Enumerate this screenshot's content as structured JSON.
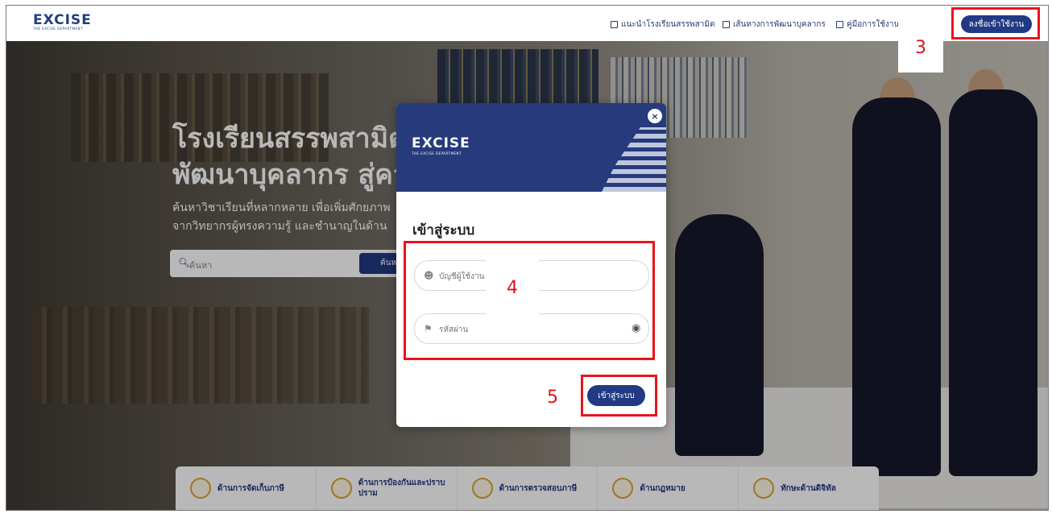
{
  "header": {
    "logo_text": "EXCISE",
    "logo_subtext": "THE EXCISE DEPARTMENT",
    "nav": [
      {
        "label": "แนะนำโรงเรียนสรรพสามิต"
      },
      {
        "label": "เส้นทางการพัฒนาบุคลากร"
      },
      {
        "label": "คู่มือการใช้งาน"
      }
    ],
    "register_label": "ลงชื่อเข้าใช้งาน"
  },
  "hero": {
    "title_line1": "โรงเรียนสรรพสามิต",
    "title_line2": "พัฒนาบุคลากร สู่ความ",
    "subtitle_line1": "ค้นหาวิชาเรียนที่หลากหลาย เพื่อเพิ่มศักยภาพ",
    "subtitle_line2": "จากวิทยากรผู้ทรงความรู้ และชำนาญในด้าน",
    "search_placeholder": "ค้นหา",
    "search_button": "ค้นหา"
  },
  "categories": [
    {
      "label": "ด้านการจัดเก็บภาษี"
    },
    {
      "label": "ด้านการป้องกันและปราบปราม"
    },
    {
      "label": "ด้านการตรวจสอบภาษี"
    },
    {
      "label": "ด้านกฎหมาย"
    },
    {
      "label": "ทักษะด้านดิจิทัล"
    }
  ],
  "modal": {
    "logo_text": "EXCISE",
    "logo_subtext": "THE EXCISE DEPARTMENT",
    "close_icon": "×",
    "title": "เข้าสู่ระบบ",
    "username_placeholder": "บัญชีผู้ใช้งาน",
    "password_placeholder": "รหัสผ่าน",
    "login_button": "เข้าสู่ระบบ"
  },
  "annotations": {
    "step3": "3",
    "step4": "4",
    "step5": "5"
  },
  "colors": {
    "primary": "#223a84",
    "annotation": "#e8141c"
  }
}
